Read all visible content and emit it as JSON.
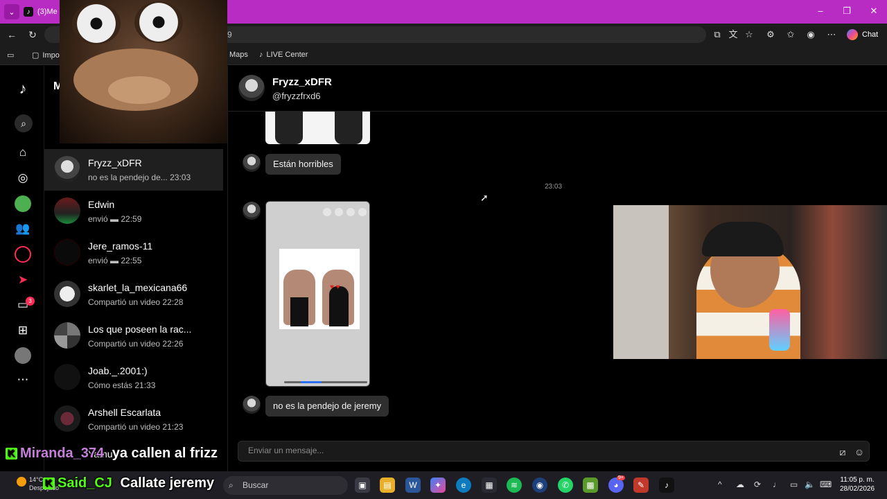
{
  "browser": {
    "tab_title": "(3)Me",
    "url_fragment": "9",
    "chat_label": "Chat",
    "favorites": [
      {
        "label": "Impo"
      },
      {
        "label": "Maps"
      },
      {
        "label": "LIVE Center"
      }
    ]
  },
  "sidebar": {
    "notification_count": "3",
    "header_initial": "M"
  },
  "conversations": [
    {
      "name": "Fryzz_xDFR",
      "preview": "no es la pendejo de...",
      "time": "23:03",
      "active": true
    },
    {
      "name": "Edwin",
      "preview": "envió ▬",
      "time": "22:59"
    },
    {
      "name": "Jere_ramos-11",
      "preview": "envió ▬",
      "time": "22:55"
    },
    {
      "name": "skarlet_la_mexicana66",
      "preview": "Compartió un video",
      "time": "22:28"
    },
    {
      "name": "Los que poseen la rac...",
      "preview": "Compartió un video",
      "time": "22:26"
    },
    {
      "name": "Joab._.2001:)",
      "preview": "Cómo estás",
      "time": "21:33"
    },
    {
      "name": "Arshell Escarlata",
      "preview": "Compartió un video",
      "time": "21:23"
    },
    {
      "name": "Yamu",
      "preview": "",
      "time": ""
    }
  ],
  "chat": {
    "contact_name": "Fryzz_xDFR",
    "contact_handle": "@fryzzfrxd6",
    "timestamp": "23:03",
    "messages": [
      {
        "text": "Están horribles"
      },
      {
        "text": "no es la pendejo de jeremy"
      }
    ],
    "input_placeholder": "Enviar un mensaje..."
  },
  "stream_chat": [
    {
      "user": "Miranda_374",
      "text": "ya callen al frizz",
      "user_color": "#c47fd9"
    },
    {
      "user": "Said_CJ",
      "text": "Callate jeremy",
      "user_color": "#53fc18"
    }
  ],
  "taskbar": {
    "weather_temp": "14°C",
    "weather_desc": "Despejado",
    "search_label": "Buscar",
    "time": "11:05 p. m.",
    "date": "28/02/2026",
    "discord_badge": "9+"
  },
  "colors": {
    "titlebar": "#b82cc4",
    "accent": "#fe2c55",
    "kick_green": "#53fc18"
  }
}
